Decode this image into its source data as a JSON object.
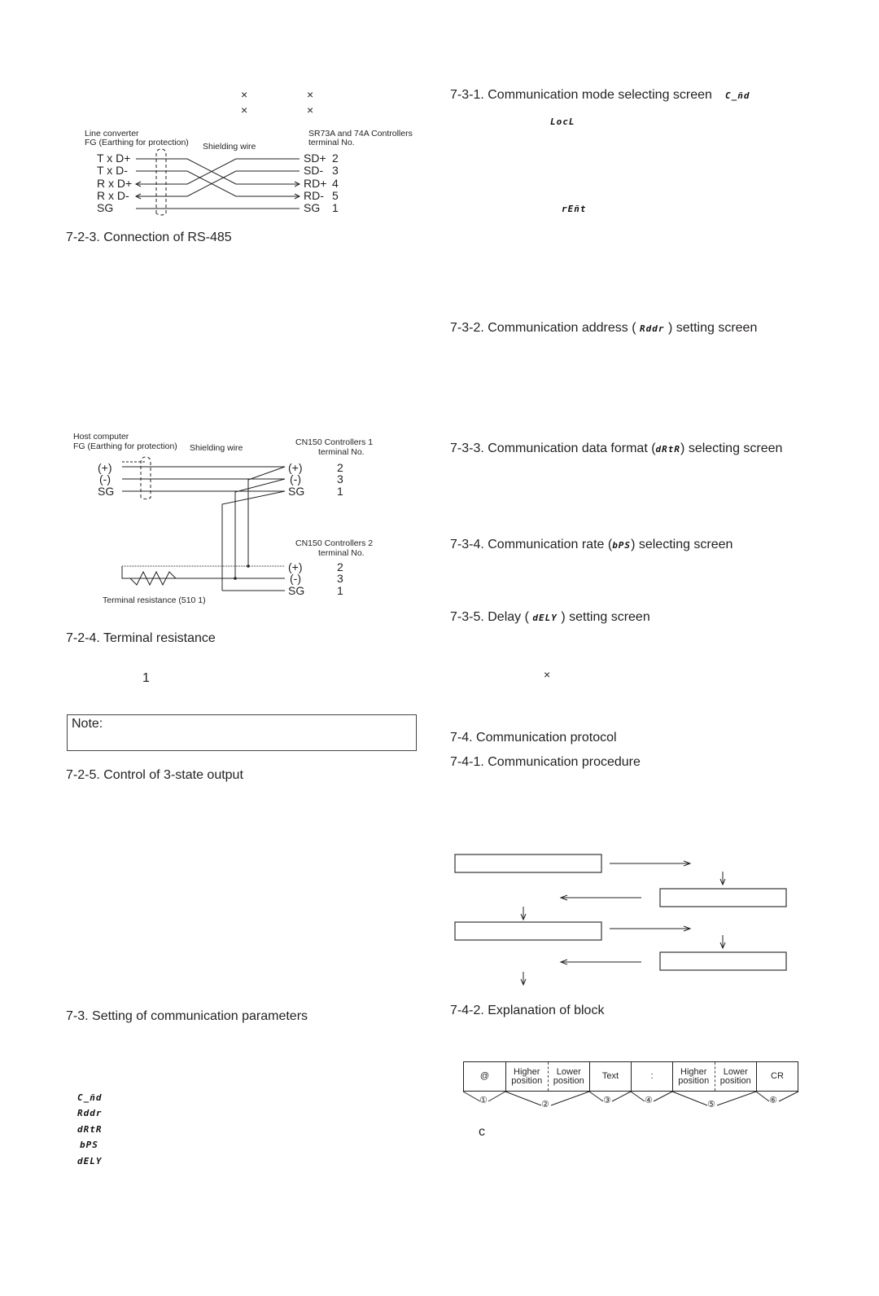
{
  "left": {
    "top_marks": [
      "×",
      "×",
      "×",
      "×"
    ],
    "rs485_diagram": {
      "left_title_1": "Line converter",
      "left_title_2": "FG (Earthing for protection)",
      "shield_label": "Shielding wire",
      "right_title_1": "SR73A and 74A Controllers",
      "right_title_2": "terminal No.",
      "left_pins": [
        "T x D+",
        "T x D-",
        "R x D+",
        "R x D-",
        "SG"
      ],
      "right_pins": [
        "SD+",
        "SD-",
        "RD+",
        "RD-",
        "SG"
      ],
      "right_nums": [
        "2",
        "3",
        "4",
        "5",
        "1"
      ]
    },
    "heading_723": "7-2-3. Connection of RS-485",
    "term_diagram": {
      "host_title_1": "Host computer",
      "host_title_2": "FG (Earthing for protection)",
      "shield_label": "Shielding wire",
      "ctrl1_title_1": "CN150 Controllers 1",
      "ctrl1_title_2": "terminal No.",
      "ctrl2_title_1": "CN150 Controllers 2",
      "ctrl2_title_2": "terminal No.",
      "host_pins": [
        "(+)",
        "(-)",
        "SG"
      ],
      "ctrl_pins": [
        "(+)",
        "(-)",
        "SG"
      ],
      "ctrl_nums": [
        "2",
        "3",
        "1"
      ],
      "resistor_label": "Terminal resistance (510 1)"
    },
    "heading_724": "7-2-4. Terminal resistance",
    "stray_one": "1",
    "note_label": "Note:",
    "heading_725": "7-2-5. Control of 3-state output",
    "heading_73": "7-3. Setting of communication parameters",
    "param_codes": [
      "C_ñd",
      "Rddr",
      "dRtR",
      "bPS",
      "dELY"
    ]
  },
  "right": {
    "heading_731": "7-3-1. Communication mode selecting screen",
    "code_731": "C_ñd",
    "code_locl": "LocL",
    "code_remt": "rEñt",
    "heading_732_a": "7-3-2. Communication address (",
    "code_732": "Rddr",
    "heading_732_b": ") setting screen",
    "heading_733_a": "7-3-3. Communication data format (",
    "code_733": "dRtR",
    "heading_733_b": ") selecting screen",
    "heading_734_a": "7-3-4. Communication rate (",
    "code_734": "bPS",
    "heading_734_b": ") selecting screen",
    "heading_735_a": "7-3-5. Delay (",
    "code_735": "dELY",
    "heading_735_b": ") setting screen",
    "stray_times": "×",
    "heading_74": "7-4. Communication protocol",
    "heading_741": "7-4-1. Communication procedure",
    "heading_742": "7-4-2. Explanation of block",
    "block": {
      "cells": [
        {
          "type": "single",
          "text": "@",
          "num": "①"
        },
        {
          "type": "split",
          "left": "Higher position",
          "right": "Lower position",
          "num": "②"
        },
        {
          "type": "single",
          "text": "Text",
          "num": "③"
        },
        {
          "type": "single",
          "text": ":",
          "num": "④"
        },
        {
          "type": "split",
          "left": "Higher position",
          "right": "Lower position",
          "num": "⑤"
        },
        {
          "type": "single",
          "text": "CR",
          "num": "⑥"
        }
      ]
    },
    "stray_c": "c"
  }
}
